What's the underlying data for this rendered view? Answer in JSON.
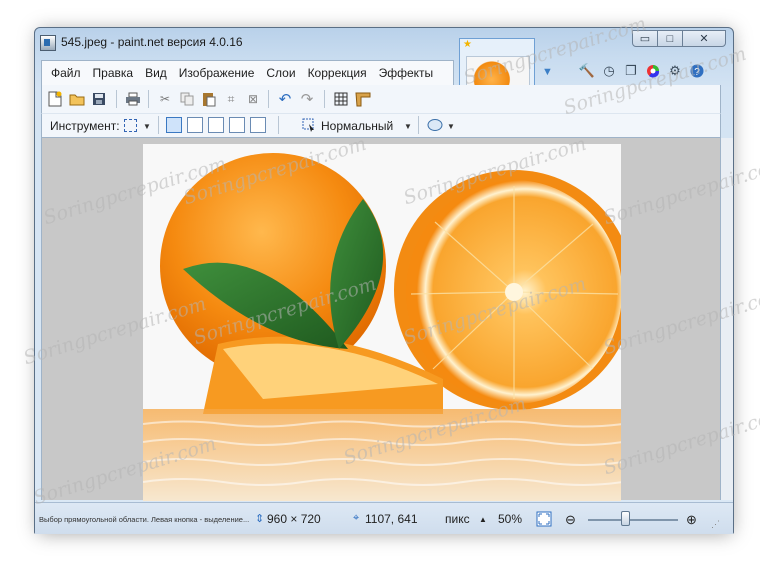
{
  "window": {
    "title": "545.jpeg - paint.net версия 4.0.16",
    "minimize_glyph": "▭",
    "maximize_glyph": "□",
    "close_glyph": "✕"
  },
  "menu": {
    "items": [
      "Файл",
      "Правка",
      "Вид",
      "Изображение",
      "Слои",
      "Коррекция",
      "Эффекты"
    ]
  },
  "toolbar": {
    "tool_label": "Инструмент:",
    "blend_mode": "Нормальный"
  },
  "status": {
    "hint": "Выбор прямоугольной области. Левая кнопка - выделение...",
    "image_size": "960 × 720",
    "cursor_pos": "1107, 641",
    "units": "пикс",
    "zoom": "50%"
  },
  "watermark": "Soringpcrepair.com",
  "colors": {
    "window_frame": "#c7dbef",
    "canvas_bg": "#c8c8c8",
    "accent": "#3a78c2"
  },
  "icons": {
    "tools": [
      "settings-hammer-icon",
      "history-clock-icon",
      "layers-icon",
      "colors-wheel-icon",
      "gear-icon",
      "help-icon"
    ]
  }
}
